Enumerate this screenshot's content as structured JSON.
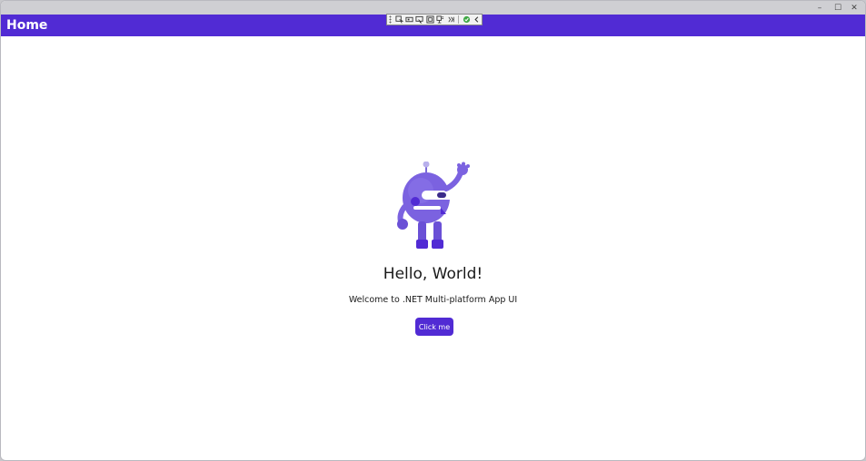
{
  "window": {
    "controls": {
      "minimize": "–",
      "maximize": "☐",
      "close": "✕"
    }
  },
  "navbar": {
    "title": "Home",
    "background": "#512bd4"
  },
  "debug_toolbar": {
    "icons": [
      "select-element-icon",
      "display-layout-adorners-icon",
      "track-focused-element-icon",
      "preview-selection-icon",
      "go-to-live-visual-tree-icon",
      "hot-reload-icon",
      "collapse-icon"
    ]
  },
  "main": {
    "image_name": "dotnet_bot",
    "heading": "Hello, World!",
    "subheading": "Welcome to .NET Multi-platform App UI",
    "button_label": "Click me",
    "accent": "#512bd4"
  }
}
